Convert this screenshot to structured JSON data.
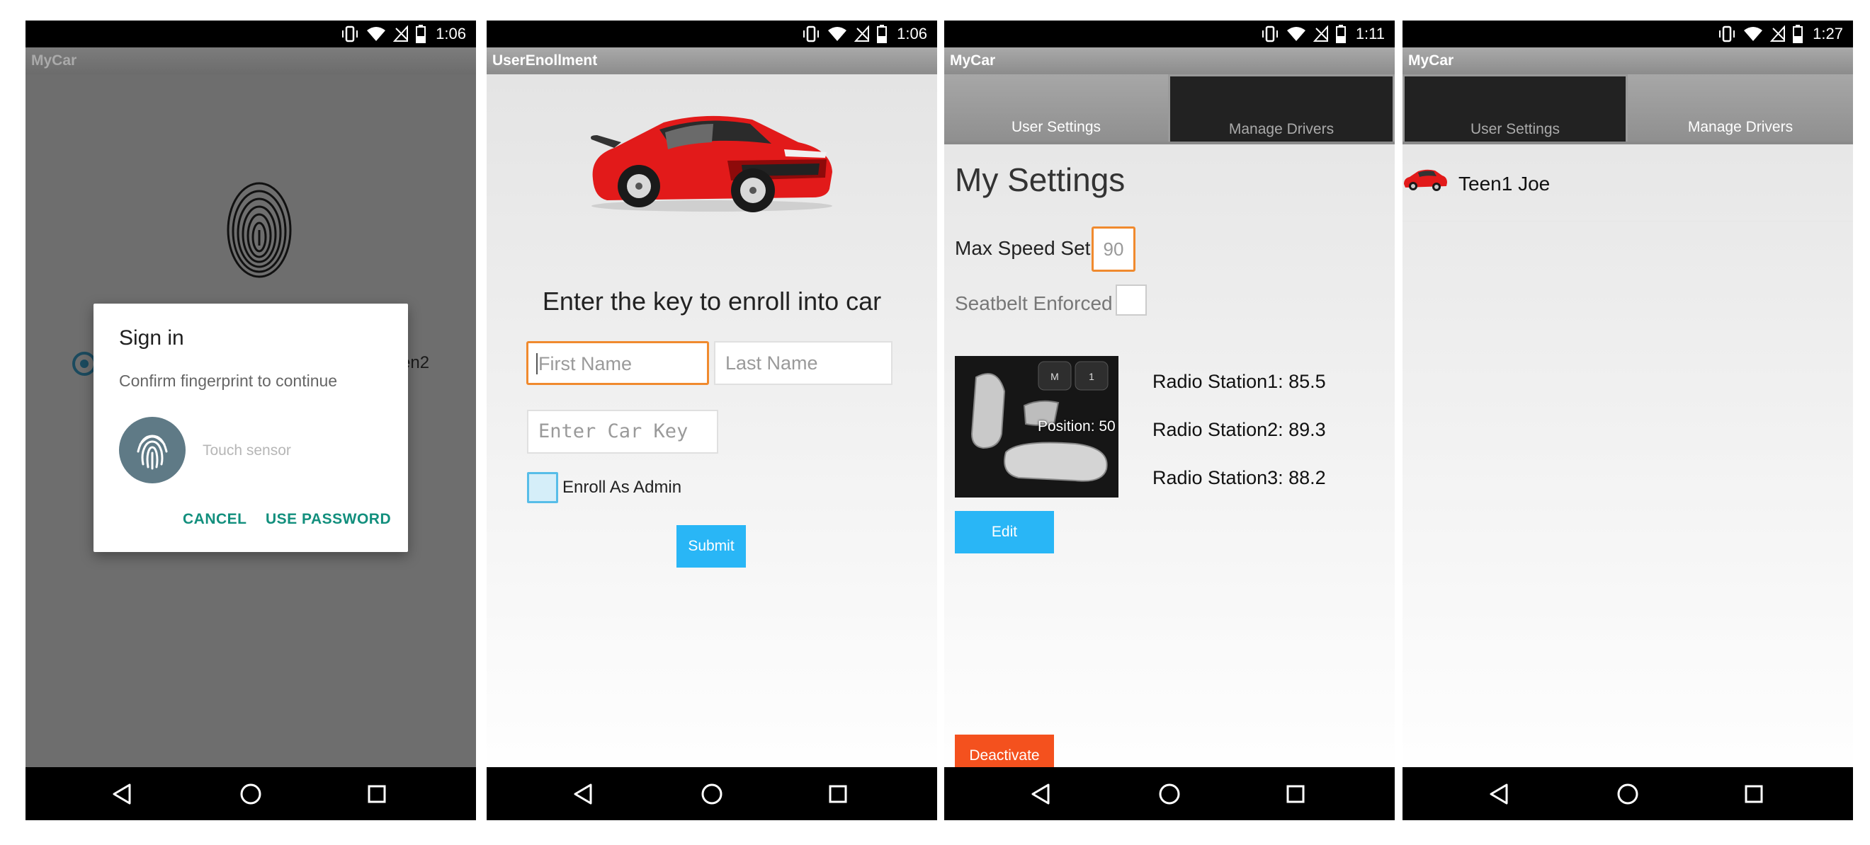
{
  "status_bars": [
    {
      "time": "1:06"
    },
    {
      "time": "1:06"
    },
    {
      "time": "1:11"
    },
    {
      "time": "1:27"
    }
  ],
  "screen1": {
    "app_title": "MyCar",
    "peek_text": "en2",
    "dialog": {
      "title": "Sign in",
      "subtitle": "Confirm fingerprint to continue",
      "touch_hint": "Touch sensor",
      "cancel": "CANCEL",
      "use_password": "USE PASSWORD"
    }
  },
  "screen2": {
    "app_title": "UserEnollment",
    "heading": "Enter the key to enroll into car",
    "first_name_placeholder": "First Name",
    "last_name_placeholder": "Last Name",
    "car_key_placeholder": "Enter Car Key",
    "enroll_admin_label": "Enroll As Admin",
    "submit": "Submit"
  },
  "screen3": {
    "app_title": "MyCar",
    "tabs": [
      {
        "label": "User Settings",
        "active": true
      },
      {
        "label": "Manage Drivers",
        "active": false
      }
    ],
    "heading": "My Settings",
    "max_speed_label": "Max Speed Set:",
    "max_speed_value": "90",
    "seatbelt_label": "Seatbelt Enforced",
    "seat_buttons": [
      "M",
      "1"
    ],
    "seat_position": "Position: 50",
    "radio_stations": [
      "Radio Station1: 85.5",
      "Radio Station2: 89.3",
      "Radio Station3: 88.2"
    ],
    "edit": "Edit",
    "deactivate": "Deactivate"
  },
  "screen4": {
    "app_title": "MyCar",
    "tabs": [
      {
        "label": "User Settings",
        "active": false
      },
      {
        "label": "Manage Drivers",
        "active": true
      }
    ],
    "drivers": [
      {
        "name": "Teen1 Joe"
      }
    ]
  },
  "colors": {
    "accent_blue": "#29b6f6",
    "focus_orange": "#f08a2e",
    "danger_orange": "#f4511e",
    "dialog_teal": "#128f7d"
  }
}
